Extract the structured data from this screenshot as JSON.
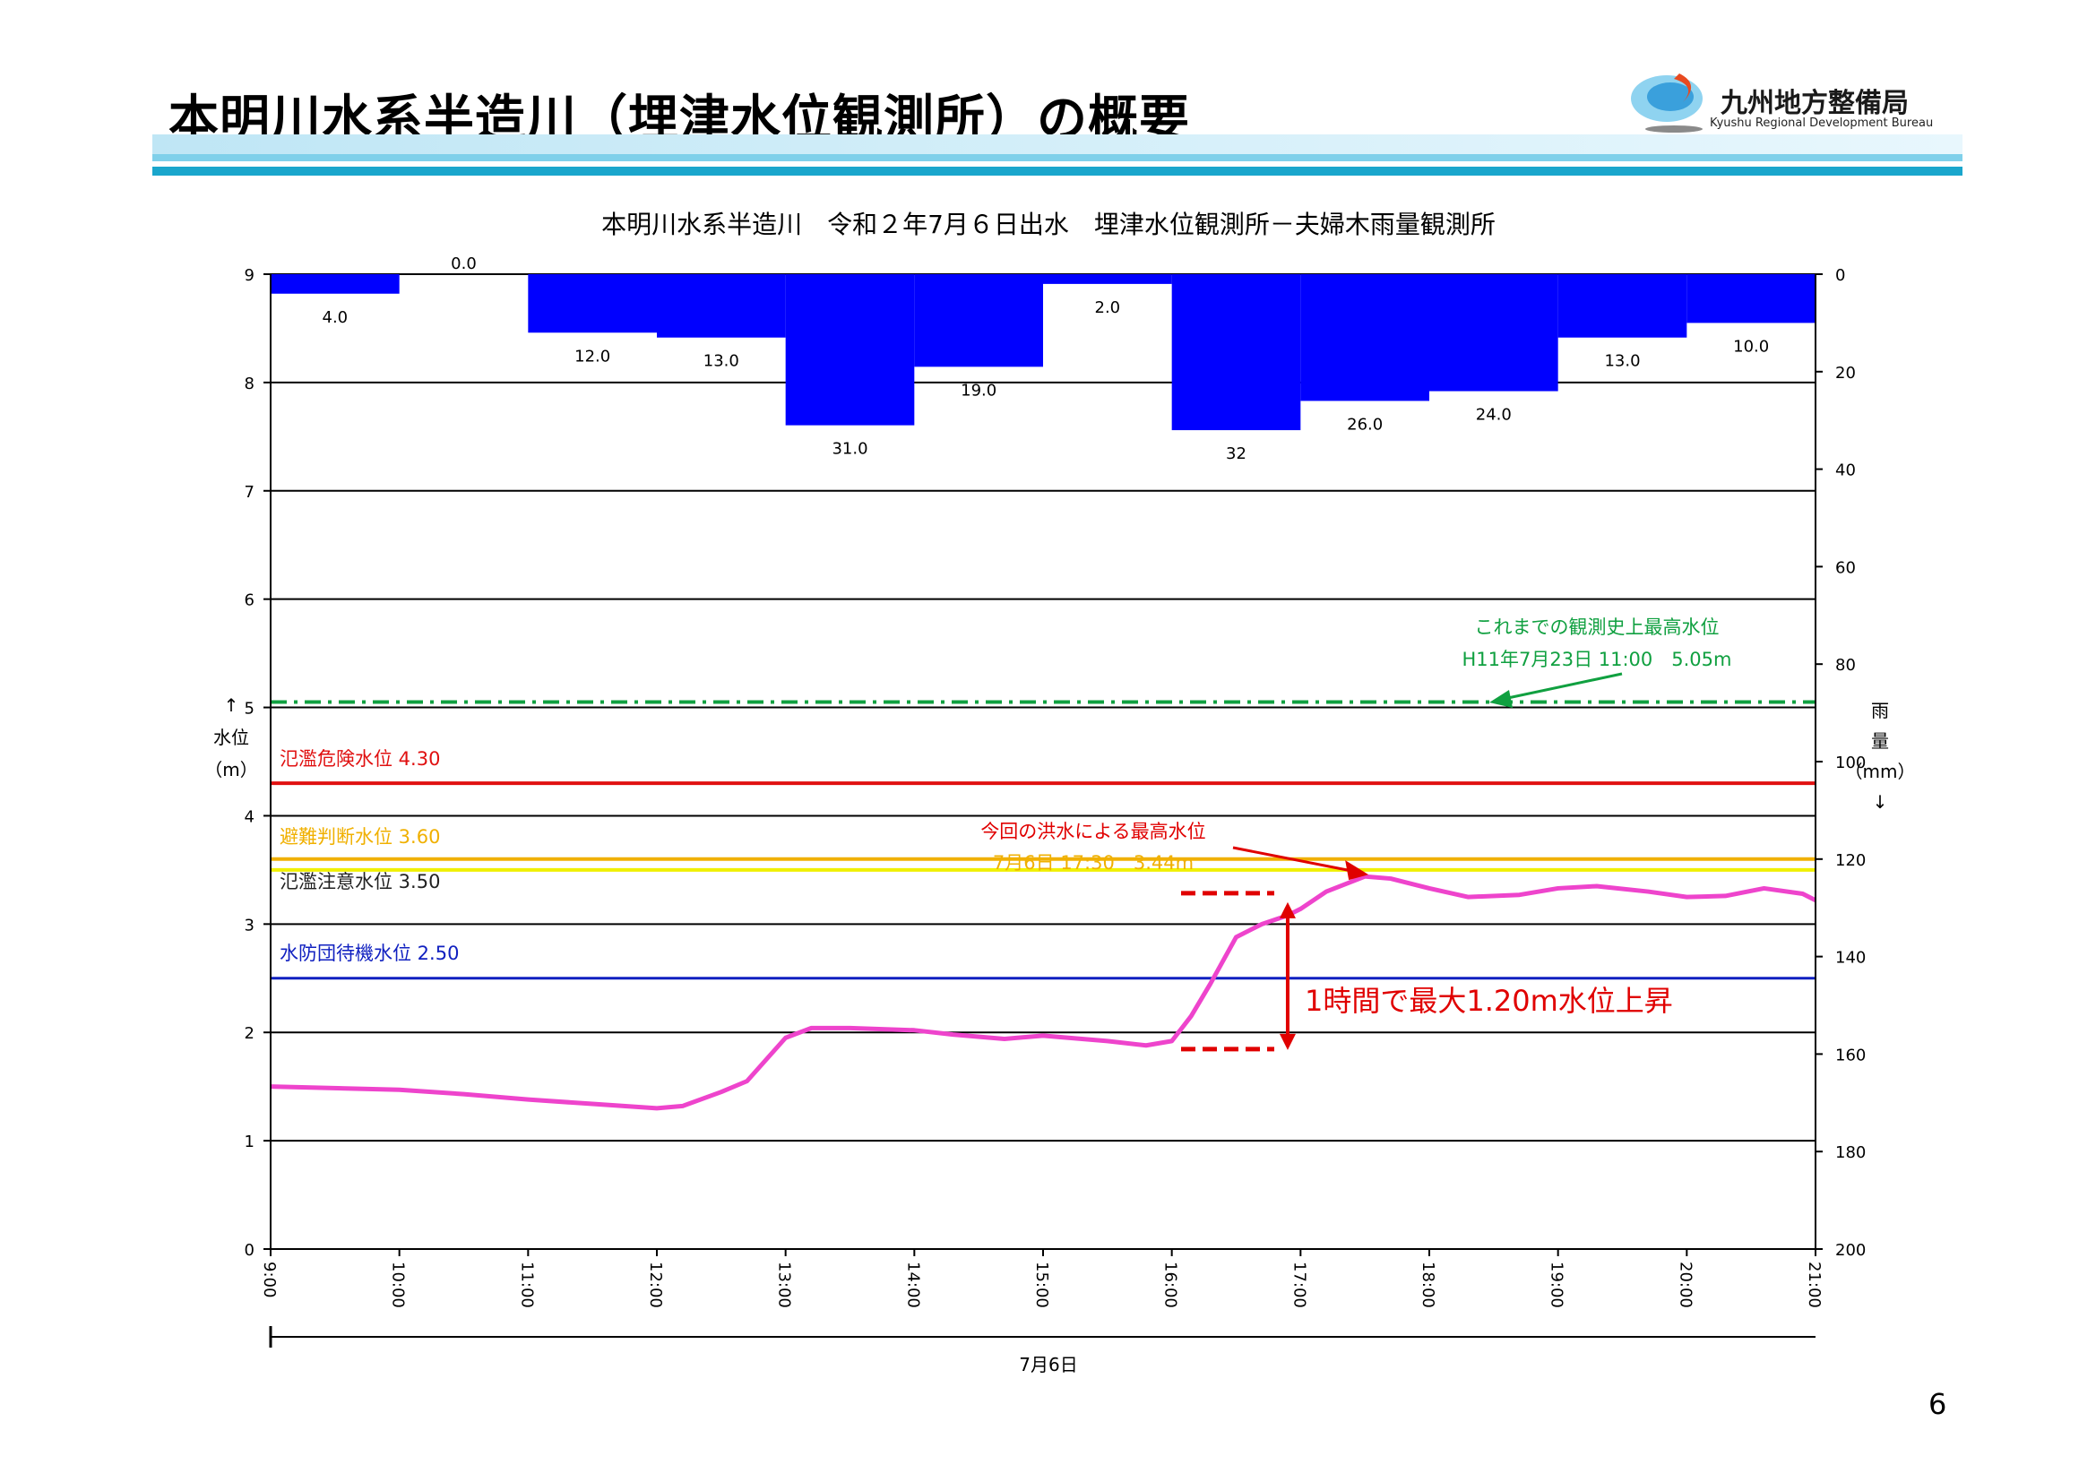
{
  "page": {
    "title": "本明川水系半造川（埋津水位観測所）の概要",
    "logo_name": "九州地方整備局",
    "logo_sub": "Kyushu Regional Development Bureau",
    "page_number": "6"
  },
  "colors": {
    "rain": "#0000ff",
    "water_level": "#ee44cc",
    "danger": "#e01010",
    "evacuation": "#f0b000",
    "caution": "#f0f000",
    "standby": "#1020c0",
    "record": "#10a040",
    "annotation_red": "#e00000"
  },
  "chart_data": {
    "type": "bar+line",
    "title": "本明川水系半造川　令和２年7月６日出水　埋津水位観測所－夫婦木雨量観測所",
    "xlabel": "7月6日",
    "y_left": {
      "label_arrow": "↑",
      "label_text": "水位",
      "label_unit": "（m）",
      "ylim": [
        0,
        9
      ],
      "ticks": [
        0,
        1,
        2,
        3,
        4,
        5,
        6,
        7,
        8,
        9
      ]
    },
    "y_right": {
      "label_1": "雨",
      "label_2": "量",
      "label_unit": "（mm）",
      "label_arrow": "↓",
      "ylim": [
        0,
        200
      ],
      "inverted": true,
      "ticks": [
        0,
        20,
        40,
        60,
        80,
        100,
        120,
        140,
        160,
        180,
        200
      ]
    },
    "x_ticks": [
      "9:00",
      "10:00",
      "11:00",
      "12:00",
      "13:00",
      "14:00",
      "15:00",
      "16:00",
      "17:00",
      "18:00",
      "19:00",
      "20:00",
      "21:00"
    ],
    "rainfall": {
      "hours": [
        9,
        10,
        11,
        12,
        13,
        14,
        15,
        16,
        17,
        18,
        19,
        20
      ],
      "values": [
        4.0,
        0.0,
        12.0,
        13.0,
        31.0,
        19.0,
        2.0,
        32,
        26.0,
        24.0,
        13.0,
        10.0
      ],
      "labels": [
        "4.0",
        "0.0",
        "12.0",
        "13.0",
        "31.0",
        "19.0",
        "2.0",
        "32",
        "26.0",
        "24.0",
        "13.0",
        "10.0"
      ]
    },
    "water_level": {
      "x": [
        9.0,
        10.0,
        10.5,
        11.0,
        11.5,
        12.0,
        12.2,
        12.5,
        12.7,
        13.0,
        13.2,
        13.5,
        14.0,
        14.3,
        14.7,
        15.0,
        15.5,
        15.8,
        16.0,
        16.15,
        16.3,
        16.5,
        16.7,
        16.9,
        17.0,
        17.2,
        17.5,
        17.7,
        18.0,
        18.3,
        18.7,
        19.0,
        19.3,
        19.7,
        20.0,
        20.3,
        20.6,
        20.9,
        21.0
      ],
      "y": [
        1.5,
        1.47,
        1.43,
        1.38,
        1.34,
        1.3,
        1.32,
        1.45,
        1.55,
        1.95,
        2.04,
        2.04,
        2.02,
        1.98,
        1.94,
        1.97,
        1.92,
        1.88,
        1.92,
        2.15,
        2.45,
        2.88,
        3.0,
        3.08,
        3.14,
        3.3,
        3.44,
        3.42,
        3.33,
        3.25,
        3.27,
        3.33,
        3.35,
        3.3,
        3.25,
        3.26,
        3.33,
        3.28,
        3.22
      ]
    },
    "thresholds": [
      {
        "name": "氾濫危険水位",
        "value_label": "4.30",
        "value": 4.3,
        "color_key": "danger",
        "dash": "solid"
      },
      {
        "name": "避難判断水位",
        "value_label": "3.60",
        "value": 3.6,
        "color_key": "evacuation",
        "dash": "solid"
      },
      {
        "name": "氾濫注意水位",
        "value_label": "3.50",
        "value": 3.5,
        "color_key": "caution",
        "dash": "solid"
      },
      {
        "name": "水防団待機水位",
        "value_label": "2.50",
        "value": 2.5,
        "color_key": "standby",
        "dash": "solid"
      }
    ],
    "record": {
      "value": 5.05,
      "line1": "これまでの観測史上最高水位",
      "line2": "H11年7月23日 11:00　5.05m"
    },
    "peak": {
      "line1": "今回の洪水による最高水位",
      "line2": "7月6日 17:30　3.44m",
      "x": 17.5,
      "y": 3.44
    },
    "rise": {
      "text": "1時間で最大1.20m水位上昇",
      "x": 16.9,
      "y_low": 1.92,
      "y_high": 3.12
    }
  }
}
